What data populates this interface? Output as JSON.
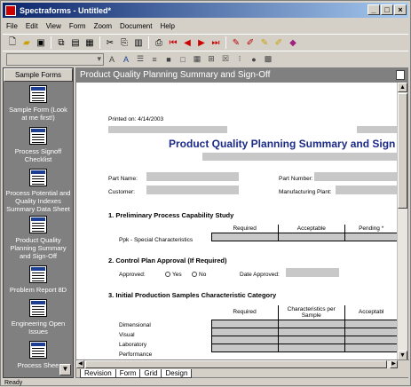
{
  "window": {
    "title": "Spectraforms - Untitled*",
    "min": "_",
    "max": "□",
    "close": "×"
  },
  "menu": [
    "File",
    "Edit",
    "View",
    "Form",
    "Zoom",
    "Document",
    "Help"
  ],
  "left_pane": {
    "header": "Sample Forms",
    "items": [
      {
        "label": "Sample Form (Look at me first!)"
      },
      {
        "label": "Process Signoff Checklist"
      },
      {
        "label": "Process Potential and Quality Indexes Summary Data Sheet"
      },
      {
        "label": "Product Quality Planning Summary and Sign-Off"
      },
      {
        "label": "Problem Report 8D"
      },
      {
        "label": "Engineering Open Issues"
      },
      {
        "label": "Process Shee"
      }
    ]
  },
  "doc": {
    "title": "Product Quality Planning Summary and Sign-Off",
    "printed_on": "Printed on:  4/14/2003",
    "form_title": "Product Quality Planning Summary and Sign",
    "part_name_label": "Part Name:",
    "part_number_label": "Part Number:",
    "customer_label": "Customer:",
    "mfg_plant_label": "Manufacturing Plant:",
    "sec1": "1.  Preliminary Process Capability Study",
    "sec1_headers": [
      "Required",
      "Acceptable",
      "Pending *"
    ],
    "sec1_row": "Ppk - Special Characteristics",
    "sec2": "2.  Control Plan Approval (If Required)",
    "approved_label": "Approved:",
    "yes_label": "Yes",
    "no_label": "No",
    "date_approved_label": "Date Approved:",
    "sec3": "3.  Initial Production Samples Characteristic Category",
    "sec3_headers": [
      "Required",
      "Characteristics per Sample",
      "Acceptabl"
    ],
    "sec3_rows": [
      "Dimensional",
      "Visual",
      "Laboratory",
      "Performance"
    ]
  },
  "tabs": [
    "Revision",
    "Form",
    "Grid",
    "Design"
  ],
  "status": "Ready"
}
